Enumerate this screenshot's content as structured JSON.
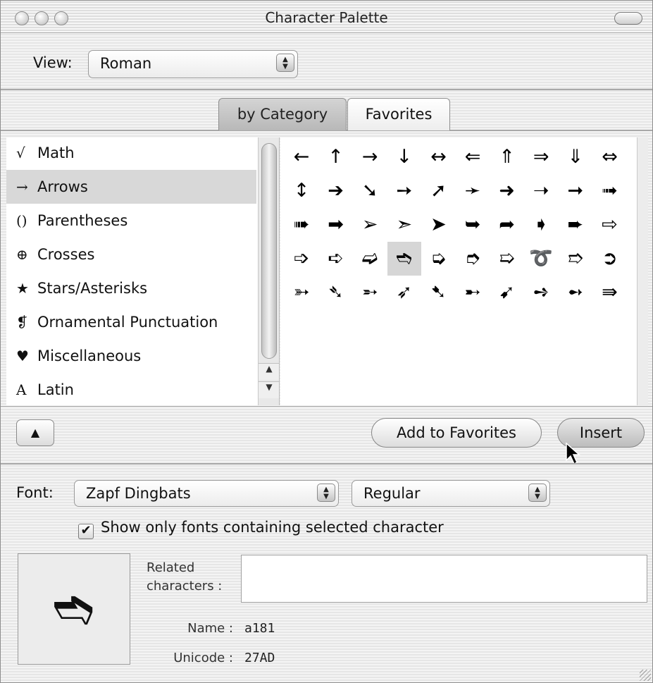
{
  "window": {
    "title": "Character Palette"
  },
  "view": {
    "label": "View:",
    "selected": "Roman"
  },
  "tabs": [
    {
      "label": "by Category",
      "active": true
    },
    {
      "label": "Favorites",
      "active": false
    }
  ],
  "categories": [
    {
      "icon": "√",
      "label": "Math"
    },
    {
      "icon": "→",
      "label": "Arrows",
      "selected": true
    },
    {
      "icon": "()",
      "label": "Parentheses"
    },
    {
      "icon": "⊕",
      "label": "Crosses"
    },
    {
      "icon": "★",
      "label": "Stars/Asterisks"
    },
    {
      "icon": "❡",
      "label": "Ornamental Punctuation"
    },
    {
      "icon": "♥",
      "label": "Miscellaneous"
    },
    {
      "icon": "A",
      "label": "Latin"
    }
  ],
  "characters": [
    [
      "←",
      "↑",
      "→",
      "↓",
      "↔",
      "⇐",
      "⇑",
      "⇒",
      "⇓",
      "⇔"
    ],
    [
      "↕",
      "➔",
      "➘",
      "➙",
      "➚",
      "➛",
      "➜",
      "➝",
      "➞",
      "➟"
    ],
    [
      "➠",
      "➡",
      "➢",
      "➣",
      "➤",
      "➥",
      "➦",
      "➧",
      "➨",
      "⇨"
    ],
    [
      "➩",
      "➪",
      "➫",
      "➬",
      "➭",
      "➮",
      "➯",
      "➰",
      "➱",
      "➲"
    ],
    [
      "➳",
      "➴",
      "➵",
      "➶",
      "➷",
      "➸",
      "➹",
      "➺",
      "➻",
      "⇛"
    ]
  ],
  "selected_char": {
    "row": 3,
    "col": 3
  },
  "buttons": {
    "expand": "▲",
    "add_favorites": "Add to Favorites",
    "insert": "Insert"
  },
  "font": {
    "label": "Font:",
    "family": "Zapf Dingbats",
    "style": "Regular"
  },
  "show_only": {
    "checked": true,
    "label": "Show only fonts containing selected character"
  },
  "detail": {
    "preview_glyph": "➬",
    "related_label_1": "Related",
    "related_label_2": "characters :",
    "name_label": "Name :",
    "name_value": "a181",
    "unicode_label": "Unicode :",
    "unicode_value": "27AD"
  }
}
